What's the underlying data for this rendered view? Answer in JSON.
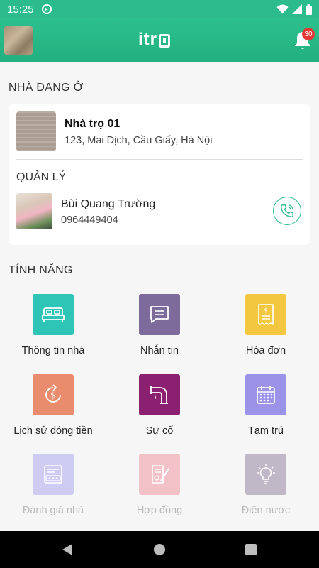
{
  "status_bar": {
    "time": "15:25",
    "icons": [
      "sync-icon",
      "wifi-icon",
      "signal-icon",
      "battery-icon"
    ]
  },
  "app_bar": {
    "logo_text": "itr",
    "notification_count": "30"
  },
  "current_home": {
    "section_title": "NHÀ ĐANG Ở",
    "name": "Nhà trọ 01",
    "address": "123, Mai Dịch, Cầu Giấy, Hà Nội",
    "manager_title": "QUẢN LÝ",
    "manager_name": "Bùi Quang Trường",
    "manager_phone": "0964449404"
  },
  "features": {
    "section_title": "TÍNH NĂNG",
    "items": [
      {
        "label": "Thông tin nhà",
        "icon": "bed-icon",
        "color": "#2ec4b6",
        "enabled": true
      },
      {
        "label": "Nhắn tin",
        "icon": "message-icon",
        "color": "#7d6b9c",
        "enabled": true
      },
      {
        "label": "Hóa đơn",
        "icon": "receipt-icon",
        "color": "#f3c73f",
        "enabled": true
      },
      {
        "label": "Lịch sử đóng tiền",
        "icon": "payment-history-icon",
        "color": "#e88c6d",
        "enabled": true
      },
      {
        "label": "Sự cố",
        "icon": "pipe-leak-icon",
        "color": "#8b2070",
        "enabled": true
      },
      {
        "label": "Tạm trú",
        "icon": "calendar-icon",
        "color": "#9b93e8",
        "enabled": true
      },
      {
        "label": "Đánh giá nhà",
        "icon": "rating-icon",
        "color": "#cfccf4",
        "enabled": false
      },
      {
        "label": "Hợp đồng",
        "icon": "contract-icon",
        "color": "#f3c1c8",
        "enabled": false
      },
      {
        "label": "Điện nước",
        "icon": "lightbulb-icon",
        "color": "#c0b8c6",
        "enabled": false
      }
    ]
  },
  "colors": {
    "primary": "#2bbb8c",
    "badge": "#e53935"
  }
}
